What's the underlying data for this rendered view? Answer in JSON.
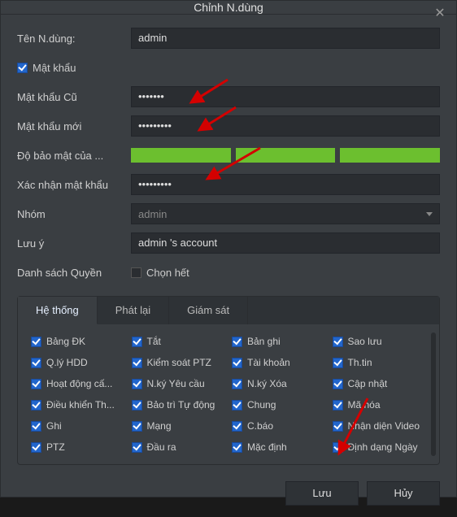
{
  "window": {
    "title": "Chỉnh N.dùng"
  },
  "labels": {
    "username": "Tên N.dùng:",
    "password_enable": "Mật khẩu",
    "old_password": "Mật khẩu Cũ",
    "new_password": "Mật khẩu mới",
    "strength": "Độ bảo mật của ...",
    "confirm": "Xác nhận mật khẩu",
    "group": "Nhóm",
    "note": "Lưu ý",
    "permissions": "Danh sách Quyền",
    "select_all": "Chọn hết"
  },
  "values": {
    "username": "admin",
    "old_password": "•••••••",
    "new_password": "•••••••••",
    "confirm": "•••••••••",
    "group": "admin",
    "note": "admin 's account"
  },
  "tabs": [
    {
      "label": "Hệ thống",
      "active": true
    },
    {
      "label": "Phát lại",
      "active": false
    },
    {
      "label": "Giám sát",
      "active": false
    }
  ],
  "permissions": [
    "Bảng ĐK",
    "Tắt",
    "Bản ghi",
    "Sao lưu",
    "Q.lý HDD",
    "Kiểm soát PTZ",
    "Tài khoản",
    "Th.tin",
    "Hoạt động cấ...",
    "N.ký Yêu cầu",
    "N.ký Xóa",
    "Cập nhật",
    "Điều khiển Th...",
    "Bảo trì Tự động",
    "Chung",
    "Mã hóa",
    "Ghi",
    "Mạng",
    "C.báo",
    "Nhận diện Video",
    "PTZ",
    "Đầu ra",
    "Mặc định",
    "Định dạng Ngày"
  ],
  "buttons": {
    "save": "Lưu",
    "cancel": "Hủy"
  },
  "colors": {
    "accent": "#2266cc",
    "strength": "#6cbf2f"
  }
}
